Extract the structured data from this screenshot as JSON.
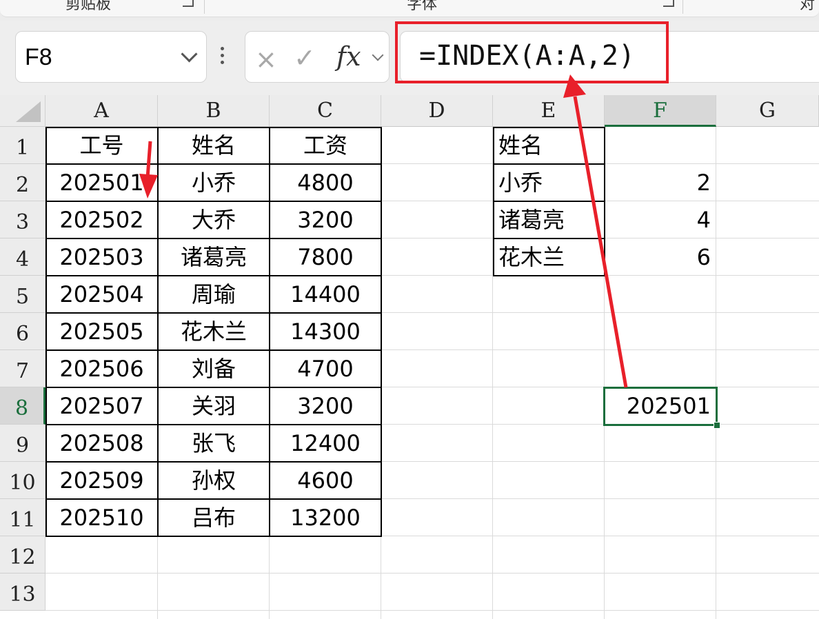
{
  "ribbon": {
    "groups": [
      "剪贴板",
      "字体",
      "对"
    ]
  },
  "formula_bar": {
    "name_box": "F8",
    "cancel_icon": "×",
    "enter_icon": "✓",
    "fx_label": "fx",
    "formula": "=INDEX(A:A,2)"
  },
  "columns": [
    "A",
    "B",
    "C",
    "D",
    "E",
    "F",
    "G"
  ],
  "rows": [
    "1",
    "2",
    "3",
    "4",
    "5",
    "6",
    "7",
    "8",
    "9",
    "10",
    "11",
    "12",
    "13"
  ],
  "selected": {
    "column": "F",
    "row": "8",
    "cell": "F8"
  },
  "table_main": {
    "headers": [
      "工号",
      "姓名",
      "工资"
    ],
    "rows": [
      [
        "202501",
        "小乔",
        "4800"
      ],
      [
        "202502",
        "大乔",
        "3200"
      ],
      [
        "202503",
        "诸葛亮",
        "7800"
      ],
      [
        "202504",
        "周瑜",
        "14400"
      ],
      [
        "202505",
        "花木兰",
        "14300"
      ],
      [
        "202506",
        "刘备",
        "4700"
      ],
      [
        "202507",
        "关羽",
        "3200"
      ],
      [
        "202508",
        "张飞",
        "12400"
      ],
      [
        "202509",
        "孙权",
        "4600"
      ],
      [
        "202510",
        "吕布",
        "13200"
      ]
    ]
  },
  "table_lookup": {
    "header": "姓名",
    "names": [
      "小乔",
      "诸葛亮",
      "花木兰"
    ],
    "indexes": [
      "2",
      "4",
      "6"
    ]
  },
  "result": {
    "value": "202501"
  },
  "annotation_color": "#e8202a",
  "selection_color": "#1a6e3c"
}
